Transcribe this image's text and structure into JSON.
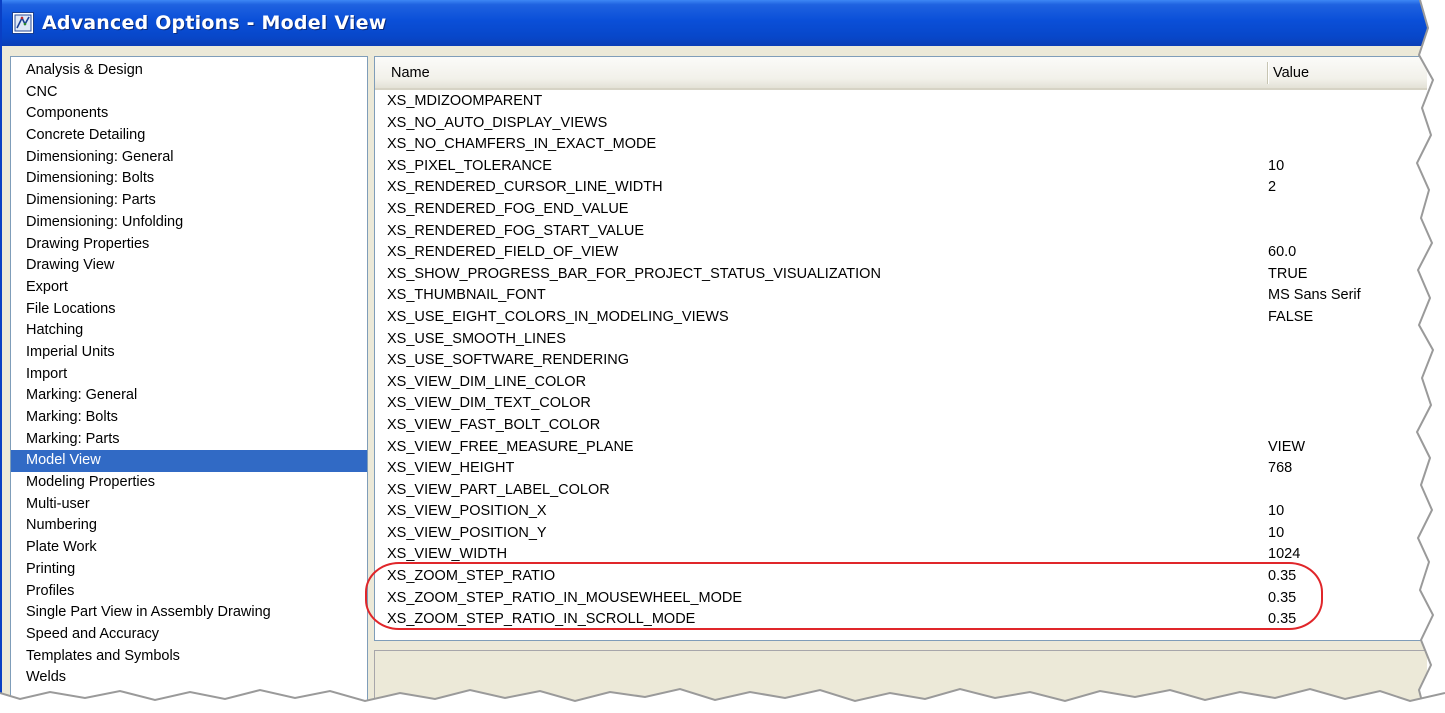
{
  "window": {
    "title": "Advanced Options - Model View",
    "icon": "app-options-icon"
  },
  "categories": {
    "selected": "Model View",
    "items": [
      "Analysis & Design",
      "CNC",
      "Components",
      "Concrete Detailing",
      "Dimensioning: General",
      "Dimensioning: Bolts",
      "Dimensioning: Parts",
      "Dimensioning: Unfolding",
      "Drawing Properties",
      "Drawing View",
      "Export",
      "File Locations",
      "Hatching",
      "Imperial Units",
      "Import",
      "Marking: General",
      "Marking: Bolts",
      "Marking: Parts",
      "Model View",
      "Modeling Properties",
      "Multi-user",
      "Numbering",
      "Plate Work",
      "Printing",
      "Profiles",
      "Single Part View in Assembly Drawing",
      "Speed and Accuracy",
      "Templates and Symbols",
      "Welds"
    ]
  },
  "table": {
    "columns": {
      "name": "Name",
      "value": "Value"
    },
    "rows": [
      {
        "name": "XS_MDIZOOMPARENT",
        "value": ""
      },
      {
        "name": "XS_NO_AUTO_DISPLAY_VIEWS",
        "value": ""
      },
      {
        "name": "XS_NO_CHAMFERS_IN_EXACT_MODE",
        "value": ""
      },
      {
        "name": "XS_PIXEL_TOLERANCE",
        "value": "10"
      },
      {
        "name": "XS_RENDERED_CURSOR_LINE_WIDTH",
        "value": "2"
      },
      {
        "name": "XS_RENDERED_FOG_END_VALUE",
        "value": ""
      },
      {
        "name": "XS_RENDERED_FOG_START_VALUE",
        "value": ""
      },
      {
        "name": "XS_RENDERED_FIELD_OF_VIEW",
        "value": "60.0"
      },
      {
        "name": "XS_SHOW_PROGRESS_BAR_FOR_PROJECT_STATUS_VISUALIZATION",
        "value": "TRUE"
      },
      {
        "name": "XS_THUMBNAIL_FONT",
        "value": "MS Sans Serif"
      },
      {
        "name": "XS_USE_EIGHT_COLORS_IN_MODELING_VIEWS",
        "value": "FALSE"
      },
      {
        "name": "XS_USE_SMOOTH_LINES",
        "value": ""
      },
      {
        "name": "XS_USE_SOFTWARE_RENDERING",
        "value": ""
      },
      {
        "name": "XS_VIEW_DIM_LINE_COLOR",
        "value": ""
      },
      {
        "name": "XS_VIEW_DIM_TEXT_COLOR",
        "value": ""
      },
      {
        "name": "XS_VIEW_FAST_BOLT_COLOR",
        "value": ""
      },
      {
        "name": "XS_VIEW_FREE_MEASURE_PLANE",
        "value": "VIEW"
      },
      {
        "name": "XS_VIEW_HEIGHT",
        "value": "768"
      },
      {
        "name": "XS_VIEW_PART_LABEL_COLOR",
        "value": ""
      },
      {
        "name": "XS_VIEW_POSITION_X",
        "value": "10"
      },
      {
        "name": "XS_VIEW_POSITION_Y",
        "value": "10"
      },
      {
        "name": "XS_VIEW_WIDTH",
        "value": "1024"
      },
      {
        "name": "XS_ZOOM_STEP_RATIO",
        "value": "0.35"
      },
      {
        "name": "XS_ZOOM_STEP_RATIO_IN_MOUSEWHEEL_MODE",
        "value": "0.35"
      },
      {
        "name": "XS_ZOOM_STEP_RATIO_IN_SCROLL_MODE",
        "value": "0.35"
      }
    ]
  },
  "colors": {
    "titlebar": "#0a4fd8",
    "selection": "#316ac5",
    "highlight_annotation": "#e0262a",
    "window_background": "#ece9d8"
  }
}
